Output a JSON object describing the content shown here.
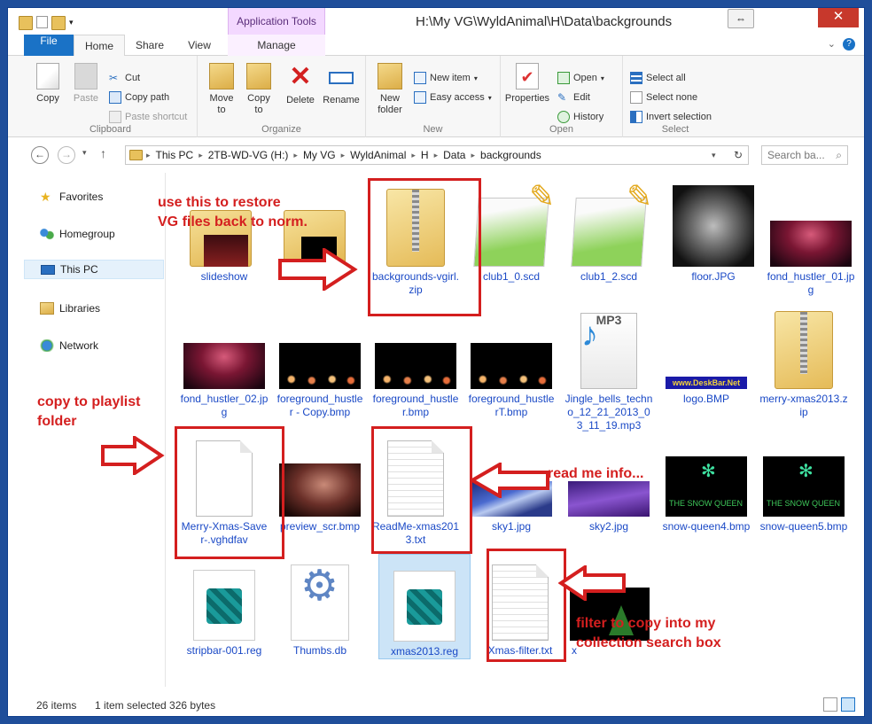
{
  "window": {
    "title": "H:\\My VG\\WyldAnimal\\H\\Data\\backgrounds",
    "context_tab": "Application Tools"
  },
  "ribbon_tabs": [
    "File",
    "Home",
    "Share",
    "View",
    "Manage"
  ],
  "ribbon": {
    "clipboard": {
      "label": "Clipboard",
      "copy": "Copy",
      "paste": "Paste",
      "cut": "Cut",
      "copy_path": "Copy path",
      "paste_shortcut": "Paste shortcut"
    },
    "organize": {
      "label": "Organize",
      "move_to": "Move to",
      "copy_to": "Copy to",
      "delete": "Delete",
      "rename": "Rename"
    },
    "new": {
      "label": "New",
      "new_folder": "New folder",
      "new_item": "New item",
      "easy_access": "Easy access"
    },
    "open": {
      "label": "Open",
      "properties": "Properties",
      "open": "Open",
      "edit": "Edit",
      "history": "History"
    },
    "select": {
      "label": "Select",
      "select_all": "Select all",
      "select_none": "Select none",
      "invert_selection": "Invert selection"
    }
  },
  "address": {
    "crumbs": [
      "This PC",
      "2TB-WD-VG (H:)",
      "My VG",
      "WyldAnimal",
      "H",
      "Data",
      "backgrounds"
    ],
    "search_placeholder": "Search ba..."
  },
  "nav": {
    "favorites": "Favorites",
    "homegroup": "Homegroup",
    "this_pc": "This PC",
    "libraries": "Libraries",
    "network": "Network"
  },
  "files": [
    {
      "name": "slideshow",
      "kind": "folder"
    },
    {
      "name": "",
      "kind": "folder-thumb"
    },
    {
      "name": "backgrounds-vgirl.zip",
      "kind": "zip"
    },
    {
      "name": "club1_0.scd",
      "kind": "npp"
    },
    {
      "name": "club1_2.scd",
      "kind": "npp"
    },
    {
      "name": "floor.JPG",
      "kind": "floor"
    },
    {
      "name": "fond_hustler_01.jpg",
      "kind": "stage"
    },
    {
      "name": "fond_hustler_02.jpg",
      "kind": "stage"
    },
    {
      "name": "foreground_hustler - Copy.bmp",
      "kind": "fg"
    },
    {
      "name": "foreground_hustler.bmp",
      "kind": "fg"
    },
    {
      "name": "foreground_hustlerT.bmp",
      "kind": "fg"
    },
    {
      "name": "Jingle_bells_techno_12_21_2013_03_11_19.mp3",
      "kind": "mp3"
    },
    {
      "name": "logo.BMP",
      "kind": "logo"
    },
    {
      "name": "merry-xmas2013.zip",
      "kind": "zip"
    },
    {
      "name": "Merry-Xmas-Saver-.vghdfav",
      "kind": "doc"
    },
    {
      "name": "preview_scr.bmp",
      "kind": "preview"
    },
    {
      "name": "ReadMe-xmas2013.txt",
      "kind": "txt"
    },
    {
      "name": "sky1.jpg",
      "kind": "sky1"
    },
    {
      "name": "sky2.jpg",
      "kind": "sky2"
    },
    {
      "name": "snow-queen4.bmp",
      "kind": "snow"
    },
    {
      "name": "snow-queen5.bmp",
      "kind": "snow"
    },
    {
      "name": "stripbar-001.reg",
      "kind": "reg"
    },
    {
      "name": "Thumbs.db",
      "kind": "thumbsdb"
    },
    {
      "name": "xmas2013.reg",
      "kind": "reg",
      "selected": true
    },
    {
      "name": "Xmas-filter.txt",
      "kind": "txt"
    },
    {
      "name": "x",
      "kind": "xmas"
    }
  ],
  "logo_text": "www.DeskBar.Net",
  "snow_text": "THE SNOW QUEEN",
  "mp3_label": "MP3",
  "status": {
    "items": "26 items",
    "selection": "1 item selected  326 bytes"
  },
  "annotations": {
    "restore": "use this to restore\nVG files back to norm.",
    "playlist": "copy to playlist\nfolder",
    "readme": "read me info...",
    "filter": "filter to copy into my\ncollection search box"
  },
  "colors": {
    "accent": "#1a72c6",
    "annotation": "#d41f1f",
    "file_text": "#1a49c6"
  }
}
